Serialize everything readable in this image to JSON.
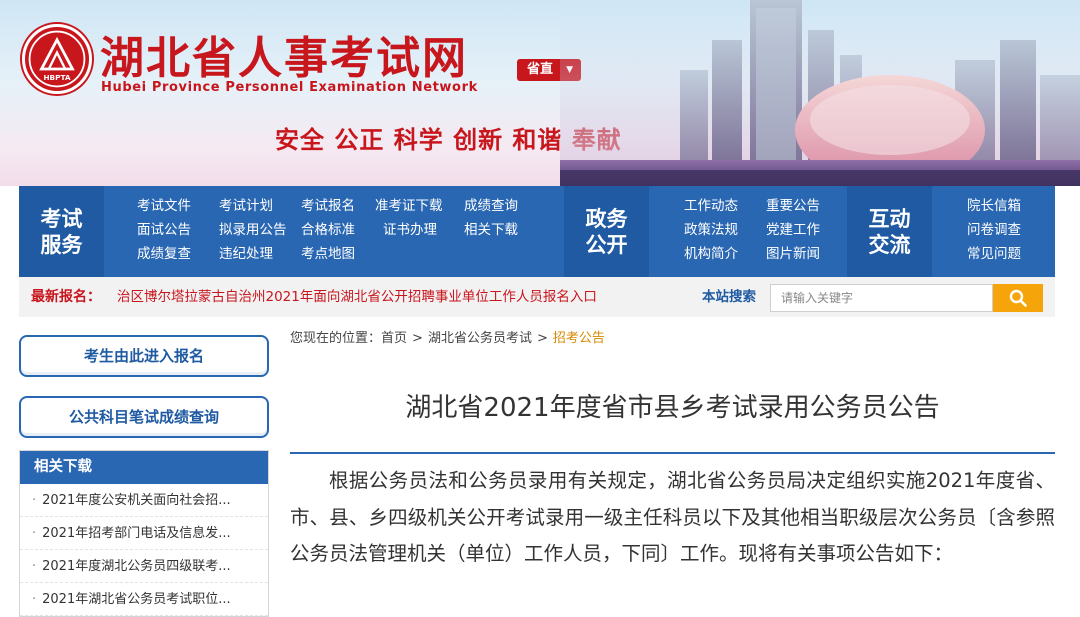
{
  "header": {
    "site_title": "湖北省人事考试网",
    "site_subtitle": "Hubei Province Personnel Examination Network",
    "logo_text": "HBPTA",
    "region_select": "省直",
    "slogan": "安全 公正 科学 创新 和谐 奉献"
  },
  "nav": {
    "sections": [
      {
        "label": "考试服务",
        "links": [
          "考试文件",
          "考试计划",
          "考试报名",
          "准考证下载",
          "成绩查询",
          "面试公告",
          "拟录用公告",
          "合格标准",
          "证书办理",
          "相关下载",
          "成绩复查",
          "违纪处理",
          "考点地图"
        ]
      },
      {
        "label": "政务公开",
        "links": [
          "工作动态",
          "重要公告",
          "政策法规",
          "党建工作",
          "机构简介",
          "图片新闻"
        ]
      },
      {
        "label": "互动交流",
        "links": [
          "院长信箱",
          "问卷调查",
          "常见问题"
        ]
      }
    ]
  },
  "newsbar": {
    "label": "最新报名：",
    "link": "治区博尔塔拉蒙古自治州2021年面向湖北省公开招聘事业单位工作人员报名入口",
    "search_label": "本站搜索",
    "search_placeholder": "请输入关键字"
  },
  "sidebar": {
    "register_button": "考生由此进入报名",
    "score_button": "公共科目笔试成绩查询",
    "downloads_title": "相关下载",
    "downloads": [
      "2021年度公安机关面向社会招...",
      "2021年招考部门电话及信息发...",
      "2021年度湖北公务员四级联考...",
      "2021年湖北省公务员考试职位..."
    ]
  },
  "breadcrumb": {
    "prefix": "您现在的位置：",
    "items": [
      "首页",
      "湖北省公务员考试",
      "招考公告"
    ],
    "separator": ">"
  },
  "article": {
    "title": "湖北省2021年度省市县乡考试录用公务员公告",
    "body": "根据公务员法和公务员录用有关规定，湖北省公务员局决定组织实施2021年度省、市、县、乡四级机关公开考试录用一级主任科员以下及其他相当职级层次公务员〔含参照公务员法管理机关（单位）工作人员，下同〕工作。现将有关事项公告如下："
  },
  "colors": {
    "brand_red": "#c8161d",
    "nav_blue": "#2a67b3",
    "nav_blue_dark": "#1f5aa2",
    "search_orange": "#f5a50a",
    "breadcrumb_current": "#d68a00"
  },
  "icons": {
    "search": "search-icon",
    "dropdown": "caret-down-icon",
    "logo": "hbpta-emblem-icon"
  }
}
